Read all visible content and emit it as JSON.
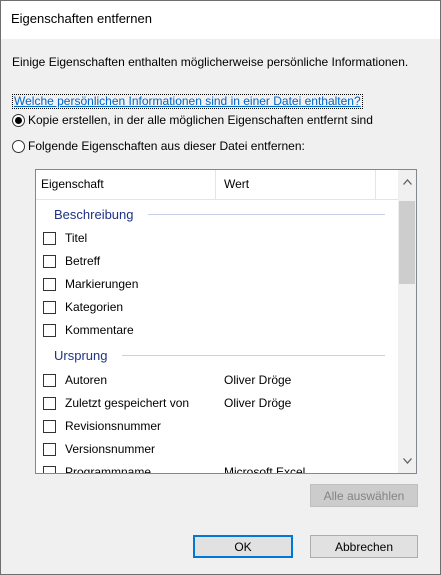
{
  "window": {
    "title": "Eigenschaften entfernen"
  },
  "intro_text": "Einige Eigenschaften enthalten möglicherweise persönliche Informationen.",
  "info_link": "Welche persönlichen Informationen sind in einer Datei enthalten?",
  "options": {
    "copy_label": "Kopie erstellen, in der alle möglichen Eigenschaften entfernt sind",
    "remove_label": "Folgende Eigenschaften aus dieser Datei entfernen:",
    "selected": "copy"
  },
  "table": {
    "columns": [
      "Eigenschaft",
      "Wert"
    ],
    "groups": [
      {
        "name": "Beschreibung",
        "items": [
          {
            "label": "Titel",
            "value": ""
          },
          {
            "label": "Betreff",
            "value": ""
          },
          {
            "label": "Markierungen",
            "value": ""
          },
          {
            "label": "Kategorien",
            "value": ""
          },
          {
            "label": "Kommentare",
            "value": ""
          }
        ]
      },
      {
        "name": "Ursprung",
        "items": [
          {
            "label": "Autoren",
            "value": "Oliver Dröge"
          },
          {
            "label": "Zuletzt gespeichert von",
            "value": "Oliver Dröge"
          },
          {
            "label": "Revisionsnummer",
            "value": ""
          },
          {
            "label": "Versionsnummer",
            "value": ""
          },
          {
            "label": "Programmname",
            "value": "Microsoft Excel"
          }
        ]
      }
    ]
  },
  "buttons": {
    "select_all": "Alle auswählen",
    "ok": "OK",
    "cancel": "Abbrechen"
  }
}
